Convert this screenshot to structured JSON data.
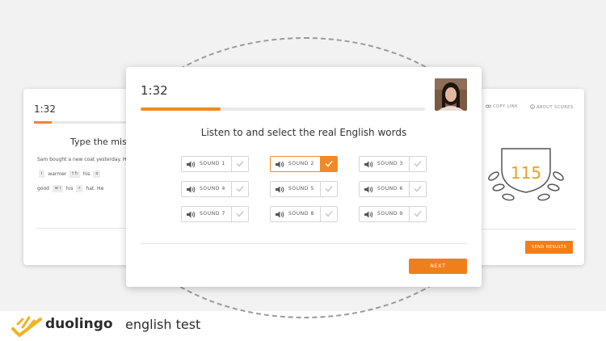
{
  "left_card": {
    "timer": "1:32",
    "progress": 0.15,
    "heading": "Type the missin",
    "lines": [
      [
        "Sam bought a new coat yesterday. H"
      ],
      [
        "i",
        "warmer",
        "t h",
        "his",
        "o"
      ],
      [
        "good",
        "w i",
        "his",
        "r",
        "hat. He"
      ]
    ]
  },
  "main_card": {
    "timer": "1:32",
    "progress": 0.28,
    "title": "Listen to and select the real English words",
    "sounds": [
      {
        "label": "SOUND 1",
        "selected": false
      },
      {
        "label": "SOUND 2",
        "selected": true
      },
      {
        "label": "SOUND 3",
        "selected": false
      },
      {
        "label": "SOUND 4",
        "selected": false
      },
      {
        "label": "SOUND 5",
        "selected": false
      },
      {
        "label": "SOUND 6",
        "selected": false
      },
      {
        "label": "SOUND 7",
        "selected": false
      },
      {
        "label": "SOUND 8",
        "selected": false
      },
      {
        "label": "SOUND 9",
        "selected": false
      }
    ],
    "next_label": "NEXT"
  },
  "right_card": {
    "copy_link": "COPY LINK",
    "about_scores": "ABOUT SCORES",
    "score": "115",
    "send_results": "SEND RESULTS"
  },
  "brand": {
    "name_bold": "duolingo",
    "name_rest": "english test"
  },
  "colors": {
    "accent": "#f08a24",
    "score": "#e9a020",
    "brand_icon": "#f0b323"
  },
  "icons": [
    "speaker-icon",
    "check-icon",
    "link-icon",
    "info-icon",
    "laurel-icon",
    "duolingo-logo-icon"
  ]
}
